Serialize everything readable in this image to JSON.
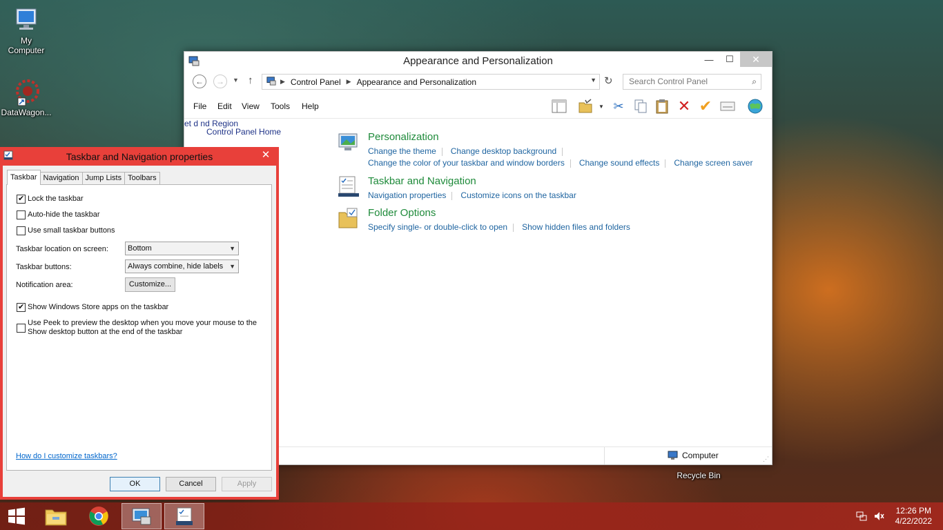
{
  "desktop": {
    "icons": [
      {
        "label": "My\nComputer",
        "line1": "My",
        "line2": "Computer"
      },
      {
        "label": "DataWagon...",
        "line1": "DataWagon..."
      },
      {
        "label": "Recycle Bin",
        "line1": "Recycle Bin"
      }
    ]
  },
  "control_panel": {
    "title": "Appearance and Personalization",
    "breadcrumb": [
      "Control Panel",
      "Appearance and Personalization"
    ],
    "search_placeholder": "Search Control Panel",
    "menu": [
      "File",
      "Edit",
      "View",
      "Tools",
      "Help"
    ],
    "left_nav": {
      "home": "Control Panel Home",
      "fragment_1": "et",
      "fragment_2": "d",
      "fragment_3": "nd Region"
    },
    "categories": [
      {
        "title": "Personalization",
        "links_line1": [
          "Change the theme",
          "Change desktop background"
        ],
        "links_line2": [
          "Change the color of your taskbar and window borders",
          "Change sound effects",
          "Change screen saver"
        ]
      },
      {
        "title": "Taskbar and Navigation",
        "links_line1": [
          "Navigation properties",
          "Customize icons on the taskbar"
        ]
      },
      {
        "title": "Folder Options",
        "links_line1": [
          "Specify single- or double-click to open",
          "Show hidden files and folders"
        ]
      }
    ],
    "status": "Computer"
  },
  "dialog": {
    "title": "Taskbar and Navigation properties",
    "tabs": [
      "Taskbar",
      "Navigation",
      "Jump Lists",
      "Toolbars"
    ],
    "active_tab": "Taskbar",
    "options": {
      "lock": {
        "label": "Lock the taskbar",
        "checked": true
      },
      "autohide": {
        "label": "Auto-hide the taskbar",
        "checked": false
      },
      "small": {
        "label": "Use small taskbar buttons",
        "checked": false
      },
      "store": {
        "label": "Show Windows Store apps on the taskbar",
        "checked": true
      },
      "peek": {
        "label_line1": "Use Peek to preview the desktop when you move your mouse to the",
        "label_line2": "Show desktop button at the end of the taskbar",
        "checked": false
      }
    },
    "location_label": "Taskbar location on screen:",
    "location_value": "Bottom",
    "buttons_label": "Taskbar buttons:",
    "buttons_value": "Always combine, hide labels",
    "notification_label": "Notification area:",
    "customize_button": "Customize...",
    "help_link": "How do I customize taskbars?",
    "ok": "OK",
    "cancel": "Cancel",
    "apply": "Apply"
  },
  "taskbar": {
    "time": "12:26 PM",
    "date": "4/22/2022"
  },
  "colors": {
    "dialog_accent": "#e8403a",
    "link_blue": "#1e64a0",
    "category_green": "#1e8a3a"
  }
}
